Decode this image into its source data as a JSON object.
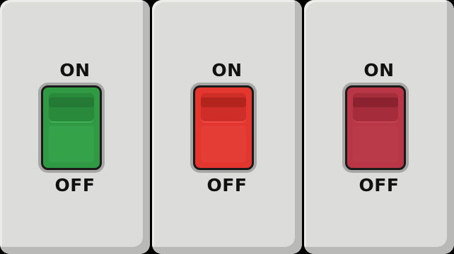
{
  "switches": [
    {
      "on_label": "ON",
      "off_label": "OFF",
      "color": "#2f9a43",
      "state": "on"
    },
    {
      "on_label": "ON",
      "off_label": "OFF",
      "color": "#e2362f",
      "state": "off"
    },
    {
      "on_label": "ON",
      "off_label": "OFF",
      "color": "#b83645",
      "state": "off"
    }
  ]
}
